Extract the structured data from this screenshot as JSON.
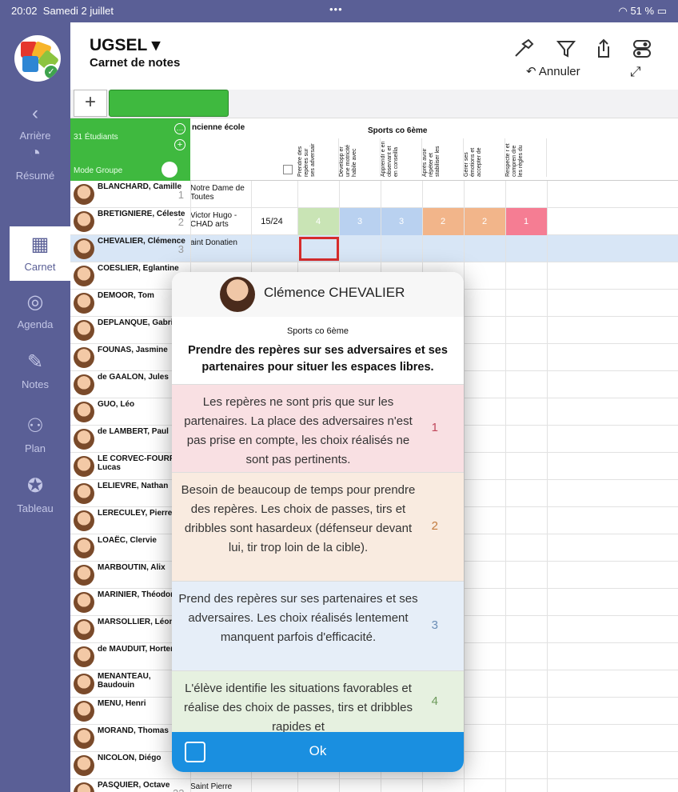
{
  "status": {
    "time": "20:02",
    "date": "Samedi 2 juillet",
    "battery": "51 %"
  },
  "sidebar": {
    "items": [
      {
        "label": "Arrière",
        "icon": "chevron-left-icon"
      },
      {
        "label": "Résumé",
        "icon": "pie-chart-icon"
      },
      {
        "label": "Carnet",
        "icon": "grid-icon",
        "active": true
      },
      {
        "label": "Agenda",
        "icon": "chat-icon"
      },
      {
        "label": "Notes",
        "icon": "pencil-icon"
      },
      {
        "label": "Plan",
        "icon": "people-icon"
      },
      {
        "label": "Tableau",
        "icon": "pin-icon"
      }
    ]
  },
  "header": {
    "title": "UGSEL ▾",
    "subtitle": "Carnet de notes",
    "undo_label": "Annuler"
  },
  "grid": {
    "students_count": "31 Étudiants",
    "mode_label": "Mode Groupe",
    "col_school": "ncienne école",
    "col_group": "Sports co 6ème",
    "criteria": [
      "Prendre des repères sur ses adversair",
      "Développ er une motricité habile avec",
      "Apprendr e en observant et en conseilla",
      "Après avoir répéter et stabiliser les",
      "Gérer ses émotions et accepter de",
      "Respecte r et compren dre les règles du"
    ],
    "rows": [
      {
        "name": "BLANCHARD, Camille",
        "num": "1",
        "school": "Notre Dame de Toutes"
      },
      {
        "name": "BRETIGNIERE, Céleste",
        "num": "2",
        "school": "Victor Hugo - CHAD arts",
        "score": "15/24",
        "levels": [
          "4",
          "3",
          "3",
          "2",
          "2",
          "1"
        ]
      },
      {
        "name": "CHEVALIER, Clémence",
        "num": "3",
        "school": "aint Donatien"
      },
      {
        "name": "COESLIER, Eglantine",
        "num": "",
        "school": ""
      },
      {
        "name": "DEMOOR, Tom",
        "num": "",
        "school": ""
      },
      {
        "name": "DEPLANQUE, Gabriel",
        "num": "",
        "school": ""
      },
      {
        "name": "FOUNAS, Jasmine",
        "num": "",
        "school": ""
      },
      {
        "name": "de GAALON, Jules",
        "num": "",
        "school": ""
      },
      {
        "name": "GUO, Léo",
        "num": "",
        "school": ""
      },
      {
        "name": "de LAMBERT, Paul",
        "num": "",
        "school": ""
      },
      {
        "name": "LE CORVEC-FOURRE, Lucas",
        "num": "",
        "school": ""
      },
      {
        "name": "LELIEVRE, Nathan",
        "num": "",
        "school": ""
      },
      {
        "name": "LERECULEY, Pierre",
        "num": "",
        "school": ""
      },
      {
        "name": "LOAËC, Clervie",
        "num": "",
        "school": ""
      },
      {
        "name": "MARBOUTIN, Alix",
        "num": "",
        "school": ""
      },
      {
        "name": "MARINIER, Théodore",
        "num": "",
        "school": ""
      },
      {
        "name": "MARSOLLIER, Léonie",
        "num": "",
        "school": ""
      },
      {
        "name": "de MAUDUIT, Hortense",
        "num": "",
        "school": ""
      },
      {
        "name": "MENANTEAU, Baudouin",
        "num": "",
        "school": ""
      },
      {
        "name": "MENU, Henri",
        "num": "",
        "school": ""
      },
      {
        "name": "MORAND, Thomas",
        "num": "",
        "school": ""
      },
      {
        "name": "NICOLON, Diégo",
        "num": "",
        "school": ""
      },
      {
        "name": "PASQUIER, Octave",
        "num": "23",
        "school": "Saint Pierre"
      }
    ]
  },
  "popover": {
    "student": "Clémence CHEVALIER",
    "course": "Sports co 6ème",
    "criterion": "Prendre des repères sur ses adversaires et ses partenaires pour situer les espaces libres.",
    "levels": [
      {
        "text": "Les repères ne sont pris que sur les partenaires. La place des adversaires n'est pas prise en compte, les choix réalisés ne sont pas pertinents.",
        "num": "1",
        "bg": "#f9e0e3",
        "color": "#c0485c"
      },
      {
        "text": "Besoin de beaucoup de temps pour prendre des repères. Les choix de passes, tirs et dribbles sont hasardeux (défenseur devant lui, tir trop loin de la cible).",
        "num": "2",
        "bg": "#f9ebe0",
        "color": "#c27a3d"
      },
      {
        "text": "Prend des repères sur ses partenaires et ses adversaires. Les choix réalisés lentement manquent parfois d'efficacité.",
        "num": "3",
        "bg": "#e6eef8",
        "color": "#6a8db6"
      },
      {
        "text": "L'élève identifie les situations favorables et réalise des choix de passes, tirs et dribbles rapides et",
        "num": "4",
        "bg": "#e6f1e0",
        "color": "#6d9a5c"
      }
    ],
    "ok_label": "Ok"
  },
  "colors": {
    "sidebar": "#5a5f96",
    "green": "#3fb93f",
    "blue": "#1a8fe0",
    "selection": "#d8e6f6",
    "level1": "#f57d93",
    "level2": "#f2b58a",
    "level3": "#b9d1f0",
    "level4": "#c9e4b5"
  }
}
